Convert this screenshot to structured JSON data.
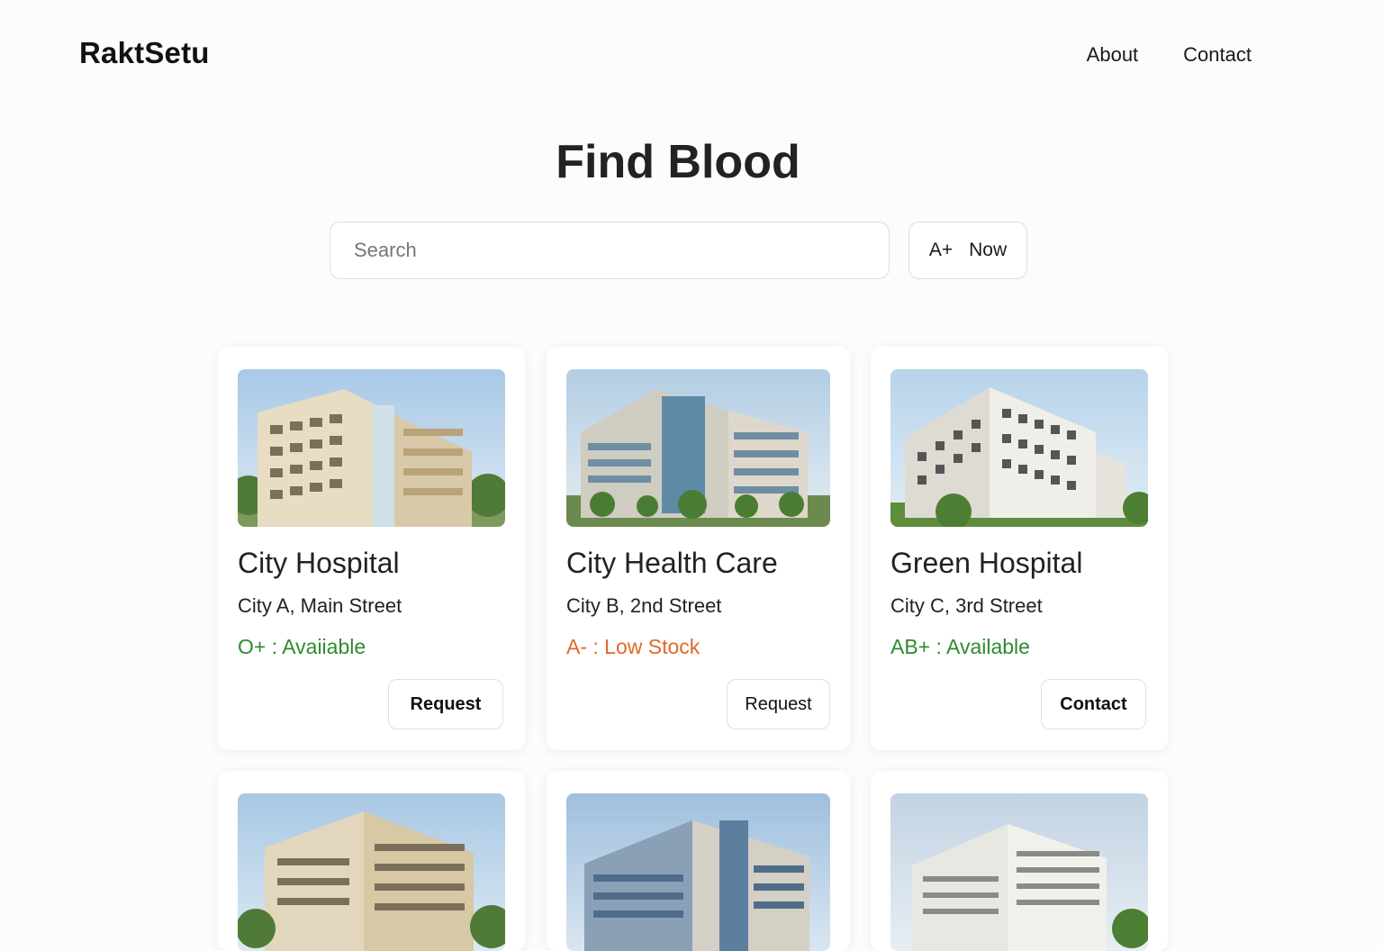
{
  "brand": "RaktSetu",
  "nav": {
    "about": "About",
    "contact": "Contact"
  },
  "page_title": "Find Blood",
  "search": {
    "placeholder": "Search",
    "value": ""
  },
  "filter": {
    "blood_group": "A+",
    "label": "Now"
  },
  "colors": {
    "available": "#2e8b2e",
    "low_stock": "#e0682a"
  },
  "hospitals": [
    {
      "name": "City Hospital",
      "address": "City A, Main Street",
      "status": "O+ : Avaiiable",
      "status_type": "available",
      "action": "Request"
    },
    {
      "name": "City Health Care",
      "address": "City B, 2nd Street",
      "status": "A- : Low Stock",
      "status_type": "low_stock",
      "action": "Request"
    },
    {
      "name": "Green Hospital",
      "address": "City C, 3rd Street",
      "status": "AB+ : Available",
      "status_type": "available",
      "action": "Contact"
    },
    {
      "name": "",
      "address": "",
      "status": "",
      "status_type": "available",
      "action": ""
    },
    {
      "name": "",
      "address": "",
      "status": "",
      "status_type": "available",
      "action": ""
    },
    {
      "name": "",
      "address": "",
      "status": "",
      "status_type": "available",
      "action": ""
    }
  ]
}
